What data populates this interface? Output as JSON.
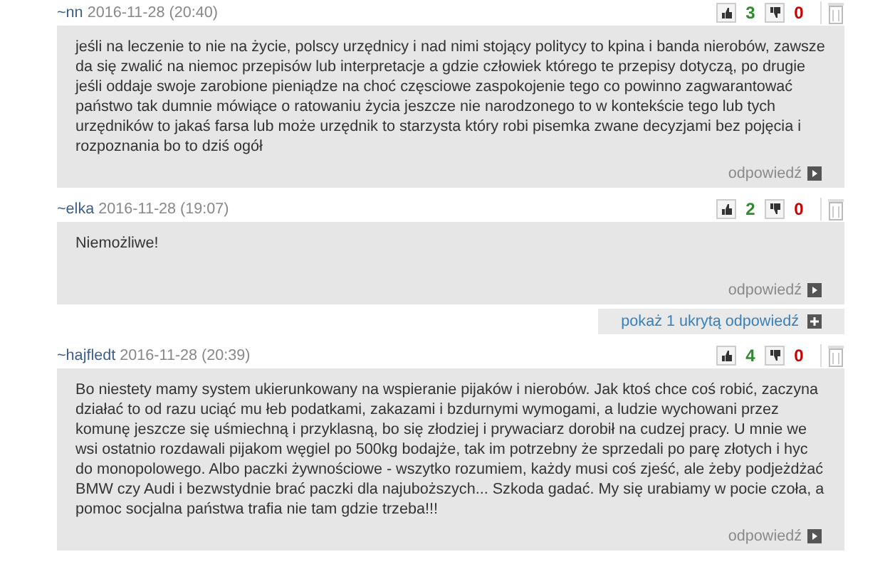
{
  "comments": [
    {
      "author": "~nn",
      "date": "2016-11-28 (20:40)",
      "likes": "3",
      "dislikes": "0",
      "text": "jeśli na leczenie to nie na życie, polscy urzędnicy i nad nimi stojący politycy to kpina i banda nierobów, zawsze da się zwalić na niemoc przepisów lub interpretacje a gdzie człowiek którego te przepisy dotyczą, po drugie jeśli oddaje swoje zarobione pieniądze na choć częsciowe zaspokojenie tego co powinno zagwarantować państwo tak dumnie mówiące o ratowaniu życia jeszcze nie narodzonego to w kontekście tego lub tych urzędników to jakaś farsa lub może urzędnik to starzysta który robi pisemka zwane decyzjami bez pojęcia i rozpoznania bo to dziś ogół",
      "reply": "odpowiedź"
    },
    {
      "author": "~elka",
      "date": "2016-11-28 (19:07)",
      "likes": "2",
      "dislikes": "0",
      "text": "Niemożliwe!",
      "reply": "odpowiedź",
      "hidden_replies": "pokaż 1 ukrytą odpowiedź"
    },
    {
      "author": "~hajfledt",
      "date": "2016-11-28 (20:39)",
      "likes": "4",
      "dislikes": "0",
      "text": "Bo niestety mamy system ukierunkowany na wspieranie pijaków i nierobów. Jak ktoś chce coś robić, zaczyna działać to od razu uciąć mu łeb podatkami, zakazami i bzdurnymi wymogami, a ludzie wychowani przez komunę jeszcze się uśmiechną i przyklasną, bo się złodziej i prywaciarz dorobił na cudzej pracy. U mnie we wsi ostatnio rozdawali pijakom węgiel po 500kg bodajże, tak im potrzebny że sprzedali po parę złotych i hyc do monopolowego. Albo paczki żywnościowe - wszytko rozumiem, każdy musi coś zjeść, ale żeby podjeżdżać BMW czy Audi i bezwstydnie brać paczki dla najuboższych... Szkoda gadać. My się urabiamy w pocie czoła, a pomoc socjalna państwa trafia nie tam gdzie trzeba!!!",
      "reply": "odpowiedź"
    }
  ]
}
